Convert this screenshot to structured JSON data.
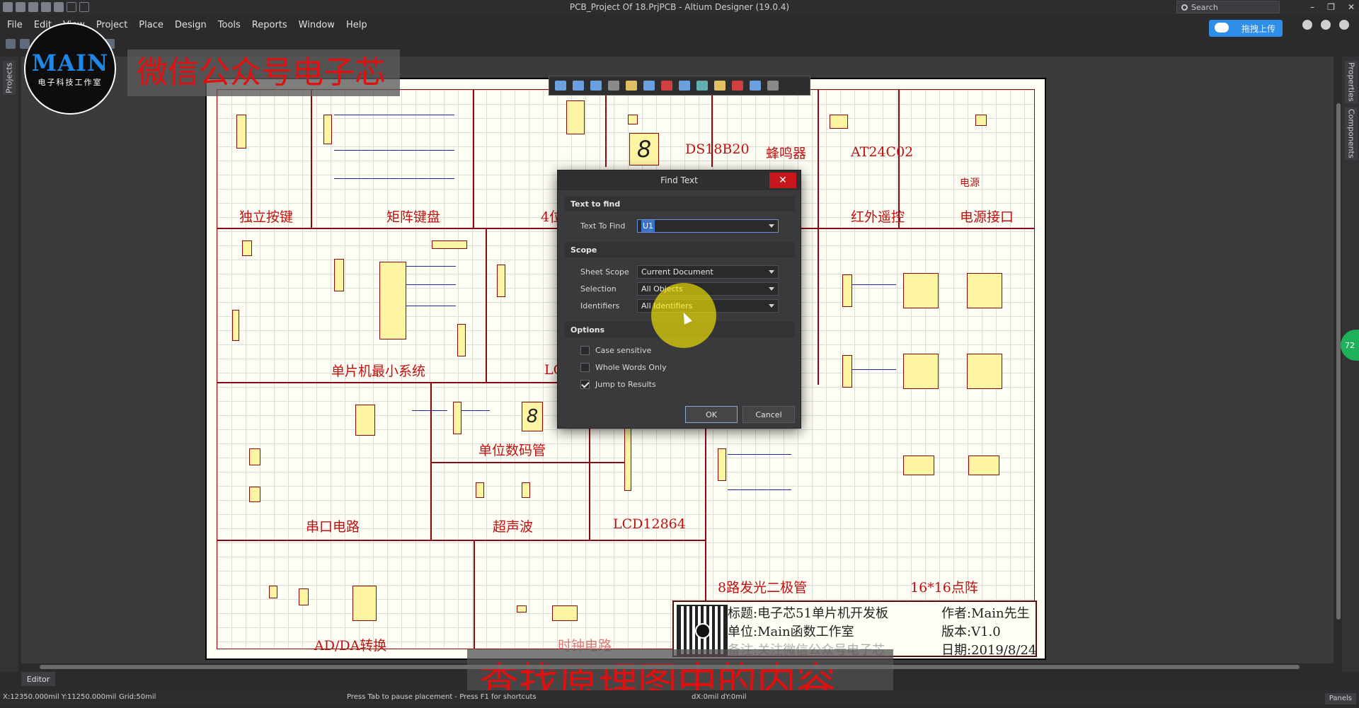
{
  "window": {
    "title": "PCB_Project Of 18.PrjPCB - Altium Designer (19.0.4)",
    "search_placeholder": "Search",
    "cloud_upload": "拖拽上传"
  },
  "menu": [
    "File",
    "Edit",
    "View",
    "Project",
    "Place",
    "Design",
    "Tools",
    "Reports",
    "Window",
    "Help"
  ],
  "side_tabs": {
    "left": "Projects",
    "right": [
      "Properties",
      "Components"
    ],
    "badge": "72"
  },
  "sheet": {
    "blocks": [
      "独立按键",
      "矩阵键盘",
      "4位数码管",
      "DS18B20",
      "蜂鸣器",
      "AT24C02",
      "红外遥控",
      "电源接口",
      "电源",
      "单片机最小系统",
      "LCD1602",
      "单位数码管",
      "串口电路",
      "超声波",
      "LCD12864",
      "8路发光二极管",
      "16*16点阵",
      "AD/DA转换",
      "时钟电路"
    ],
    "seg_digit_large": "8",
    "seg_digit_small": "8",
    "title_block": {
      "title": "标题:电子芯51单片机开发板",
      "author": "作者:Main先生",
      "unit": "单位:Main函数工作室",
      "version": "版本:V1.0",
      "note": "备注:关注微信公众号电子芯",
      "date": "日期:2019/8/24"
    }
  },
  "dialog": {
    "title": "Find Text",
    "section_text": "Text to find",
    "label_text_to_find": "Text To Find",
    "text_to_find_value": "U1",
    "section_scope": "Scope",
    "label_sheet_scope": "Sheet Scope",
    "sheet_scope_value": "Current Document",
    "label_selection": "Selection",
    "selection_value": "All Objects",
    "label_identifiers": "Identifiers",
    "identifiers_value": "All Identifiers",
    "section_options": "Options",
    "opt_case": "Case sensitive",
    "opt_whole": "Whole Words Only",
    "opt_jump": "Jump to Results",
    "opt_case_checked": false,
    "opt_whole_checked": false,
    "opt_jump_checked": true,
    "ok": "OK",
    "cancel": "Cancel"
  },
  "watermark": {
    "logo_main": "MAIN",
    "logo_sub": "电子科技工作室",
    "wechat": "微信公众号电子芯",
    "caption": "查找原理图中的内容"
  },
  "status": {
    "coords": "X:12350.000mil Y:11250.000mil",
    "grid": "Grid:50mil",
    "hint": "Press Tab to pause placement - Press F1 for shortcuts",
    "delta": "dX:0mil dY:0mil",
    "panels": "Panels",
    "editor_tab": "Editor"
  },
  "colors": {
    "accent": "#2f8fe8",
    "close_red": "#c8161d",
    "schematic_border": "#8a0a14",
    "label_red": "#c01010",
    "chip_fill": "#fdf5a4",
    "wire_blue": "#1a2a9a"
  }
}
